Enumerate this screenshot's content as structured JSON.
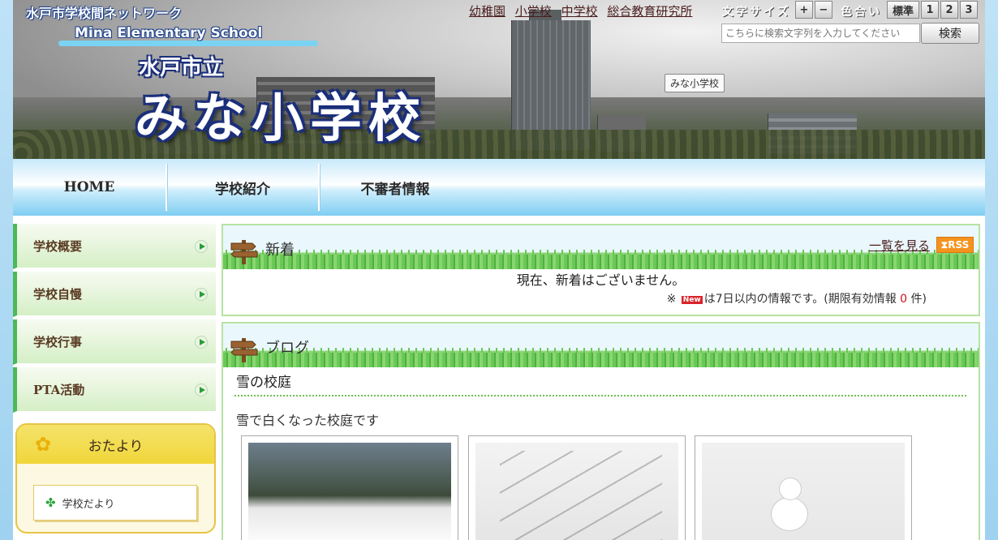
{
  "header": {
    "network_title": "水戸市学校間ネットワーク",
    "english_name": "Mina Elementary School",
    "city": "水戸市立",
    "school_name": "みな小学校",
    "tooltip": "みな小学校"
  },
  "top_links": [
    "幼稚園",
    "小学校",
    "中学校",
    "総合教育研究所"
  ],
  "tools": {
    "font_size_label": "文字サイズ",
    "font_plus": "+",
    "font_minus": "−",
    "color_label": "色合い",
    "color_standard": "標準",
    "color_1": "1",
    "color_2": "2",
    "color_3": "3"
  },
  "search": {
    "placeholder": "こちらに検索文字列を入力してください",
    "button": "検索"
  },
  "nav": [
    "HOME",
    "学校紹介",
    "不審者情報"
  ],
  "sidebar": {
    "items": [
      "学校概要",
      "学校自慢",
      "学校行事",
      "PTA活動"
    ],
    "otayori_title": "おたより",
    "otayori_link": "学校だより"
  },
  "news": {
    "title": "新着",
    "list_link": "一覧を見る",
    "rss": "RSS",
    "empty": "現在、新着はございません。",
    "note_prefix": "※",
    "new_badge": "New",
    "note_middle": "は7日以内の情報です。(期限有効情報",
    "count": "0",
    "note_suffix": "件)"
  },
  "blog": {
    "title": "ブログ",
    "post_title": "雪の校庭",
    "post_text": "雪で白くなった校庭です"
  },
  "colors": {
    "frame_blue": "#9ed2f0",
    "green_accent": "#4cb85a",
    "yellow_panel": "#f0d63a",
    "rss_orange": "#f5931e",
    "new_red": "#d8232a"
  }
}
